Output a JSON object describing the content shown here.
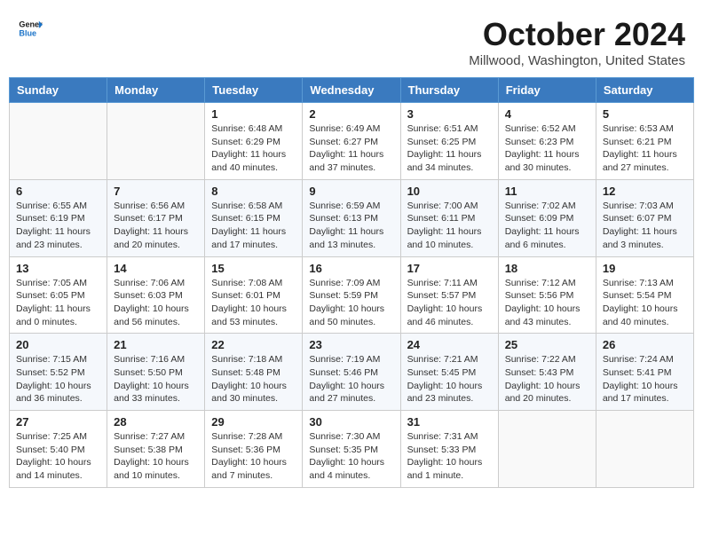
{
  "header": {
    "logo_line1": "General",
    "logo_line2": "Blue",
    "month": "October 2024",
    "location": "Millwood, Washington, United States"
  },
  "weekdays": [
    "Sunday",
    "Monday",
    "Tuesday",
    "Wednesday",
    "Thursday",
    "Friday",
    "Saturday"
  ],
  "weeks": [
    [
      null,
      null,
      {
        "day": 1,
        "sunrise": "6:48 AM",
        "sunset": "6:29 PM",
        "daylight": "11 hours and 40 minutes."
      },
      {
        "day": 2,
        "sunrise": "6:49 AM",
        "sunset": "6:27 PM",
        "daylight": "11 hours and 37 minutes."
      },
      {
        "day": 3,
        "sunrise": "6:51 AM",
        "sunset": "6:25 PM",
        "daylight": "11 hours and 34 minutes."
      },
      {
        "day": 4,
        "sunrise": "6:52 AM",
        "sunset": "6:23 PM",
        "daylight": "11 hours and 30 minutes."
      },
      {
        "day": 5,
        "sunrise": "6:53 AM",
        "sunset": "6:21 PM",
        "daylight": "11 hours and 27 minutes."
      }
    ],
    [
      {
        "day": 6,
        "sunrise": "6:55 AM",
        "sunset": "6:19 PM",
        "daylight": "11 hours and 23 minutes."
      },
      {
        "day": 7,
        "sunrise": "6:56 AM",
        "sunset": "6:17 PM",
        "daylight": "11 hours and 20 minutes."
      },
      {
        "day": 8,
        "sunrise": "6:58 AM",
        "sunset": "6:15 PM",
        "daylight": "11 hours and 17 minutes."
      },
      {
        "day": 9,
        "sunrise": "6:59 AM",
        "sunset": "6:13 PM",
        "daylight": "11 hours and 13 minutes."
      },
      {
        "day": 10,
        "sunrise": "7:00 AM",
        "sunset": "6:11 PM",
        "daylight": "11 hours and 10 minutes."
      },
      {
        "day": 11,
        "sunrise": "7:02 AM",
        "sunset": "6:09 PM",
        "daylight": "11 hours and 6 minutes."
      },
      {
        "day": 12,
        "sunrise": "7:03 AM",
        "sunset": "6:07 PM",
        "daylight": "11 hours and 3 minutes."
      }
    ],
    [
      {
        "day": 13,
        "sunrise": "7:05 AM",
        "sunset": "6:05 PM",
        "daylight": "11 hours and 0 minutes."
      },
      {
        "day": 14,
        "sunrise": "7:06 AM",
        "sunset": "6:03 PM",
        "daylight": "10 hours and 56 minutes."
      },
      {
        "day": 15,
        "sunrise": "7:08 AM",
        "sunset": "6:01 PM",
        "daylight": "10 hours and 53 minutes."
      },
      {
        "day": 16,
        "sunrise": "7:09 AM",
        "sunset": "5:59 PM",
        "daylight": "10 hours and 50 minutes."
      },
      {
        "day": 17,
        "sunrise": "7:11 AM",
        "sunset": "5:57 PM",
        "daylight": "10 hours and 46 minutes."
      },
      {
        "day": 18,
        "sunrise": "7:12 AM",
        "sunset": "5:56 PM",
        "daylight": "10 hours and 43 minutes."
      },
      {
        "day": 19,
        "sunrise": "7:13 AM",
        "sunset": "5:54 PM",
        "daylight": "10 hours and 40 minutes."
      }
    ],
    [
      {
        "day": 20,
        "sunrise": "7:15 AM",
        "sunset": "5:52 PM",
        "daylight": "10 hours and 36 minutes."
      },
      {
        "day": 21,
        "sunrise": "7:16 AM",
        "sunset": "5:50 PM",
        "daylight": "10 hours and 33 minutes."
      },
      {
        "day": 22,
        "sunrise": "7:18 AM",
        "sunset": "5:48 PM",
        "daylight": "10 hours and 30 minutes."
      },
      {
        "day": 23,
        "sunrise": "7:19 AM",
        "sunset": "5:46 PM",
        "daylight": "10 hours and 27 minutes."
      },
      {
        "day": 24,
        "sunrise": "7:21 AM",
        "sunset": "5:45 PM",
        "daylight": "10 hours and 23 minutes."
      },
      {
        "day": 25,
        "sunrise": "7:22 AM",
        "sunset": "5:43 PM",
        "daylight": "10 hours and 20 minutes."
      },
      {
        "day": 26,
        "sunrise": "7:24 AM",
        "sunset": "5:41 PM",
        "daylight": "10 hours and 17 minutes."
      }
    ],
    [
      {
        "day": 27,
        "sunrise": "7:25 AM",
        "sunset": "5:40 PM",
        "daylight": "10 hours and 14 minutes."
      },
      {
        "day": 28,
        "sunrise": "7:27 AM",
        "sunset": "5:38 PM",
        "daylight": "10 hours and 10 minutes."
      },
      {
        "day": 29,
        "sunrise": "7:28 AM",
        "sunset": "5:36 PM",
        "daylight": "10 hours and 7 minutes."
      },
      {
        "day": 30,
        "sunrise": "7:30 AM",
        "sunset": "5:35 PM",
        "daylight": "10 hours and 4 minutes."
      },
      {
        "day": 31,
        "sunrise": "7:31 AM",
        "sunset": "5:33 PM",
        "daylight": "10 hours and 1 minute."
      },
      null,
      null
    ]
  ]
}
